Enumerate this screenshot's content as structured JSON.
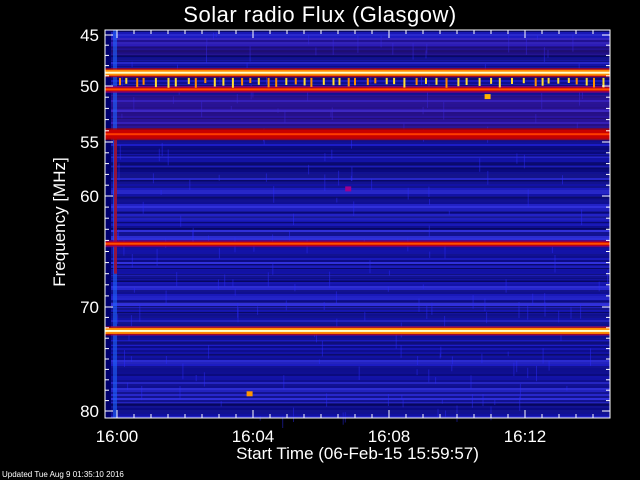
{
  "chart_data": {
    "type": "heatmap",
    "title": "Solar radio Flux (Glasgow)",
    "xlabel": "Start Time (06-Feb-15 15:59:57)",
    "ylabel": "Frequency [MHz]",
    "x_ticks": [
      {
        "label": "16:00",
        "minutes": 0
      },
      {
        "label": "16:04",
        "minutes": 4
      },
      {
        "label": "16:08",
        "minutes": 8
      },
      {
        "label": "16:12",
        "minutes": 12
      }
    ],
    "y_ticks": [
      45,
      50,
      55,
      60,
      70,
      80
    ],
    "ylim": [
      45,
      80
    ],
    "xlim_minutes": [
      0,
      14.5
    ],
    "colormap": [
      "#000050",
      "#0000c8",
      "#3c28ff",
      "#8c00a0",
      "#c80000",
      "#ff6400",
      "#ffdc32",
      "#ffffc8"
    ],
    "bands": [
      {
        "freq": 48.7,
        "intensity": "high"
      },
      {
        "freq": 50.3,
        "intensity": "medium"
      },
      {
        "freq": 54.3,
        "intensity": "medium-high"
      },
      {
        "freq": 64.3,
        "intensity": "medium"
      },
      {
        "freq": 72.3,
        "intensity": "high"
      }
    ]
  },
  "footer": "Updated Tue Aug  9 01:35:10 2016"
}
